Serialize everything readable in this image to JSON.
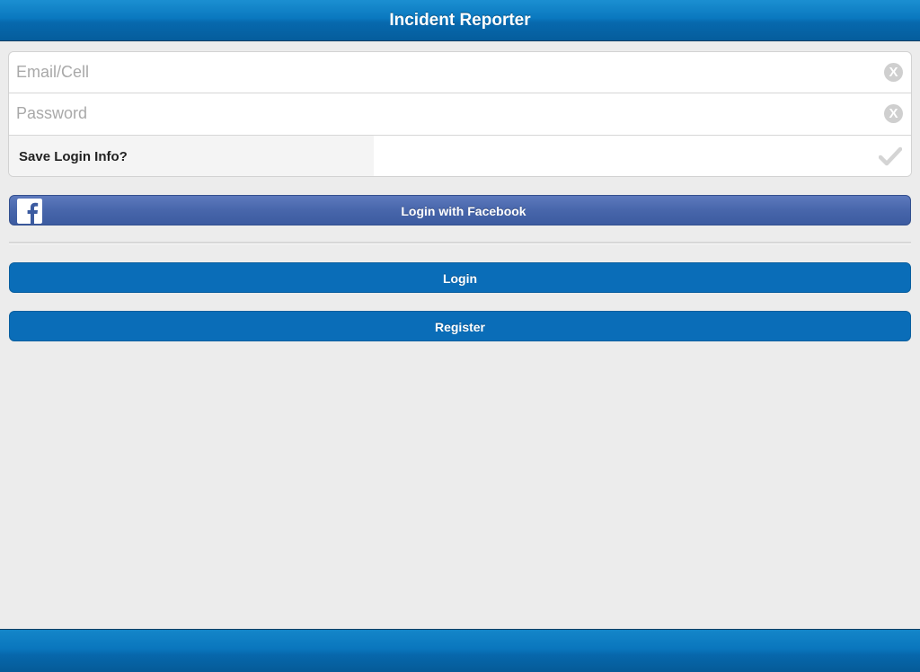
{
  "header": {
    "title": "Incident Reporter"
  },
  "login_form": {
    "email_placeholder": "Email/Cell",
    "email_value": "",
    "password_placeholder": "Password",
    "password_value": "",
    "clear_icon_glyph": "X",
    "save_login_label": "Save Login Info?",
    "save_login_checked": false,
    "check_icon": "checkmark-icon"
  },
  "buttons": {
    "facebook_label": "Login with Facebook",
    "facebook_icon": "facebook-logo-icon",
    "login_label": "Login",
    "register_label": "Register"
  },
  "colors": {
    "navbar_blue": "#0a78bf",
    "primary_button": "#0a6db8",
    "facebook_blue": "#4866ab",
    "background": "#ececec"
  }
}
